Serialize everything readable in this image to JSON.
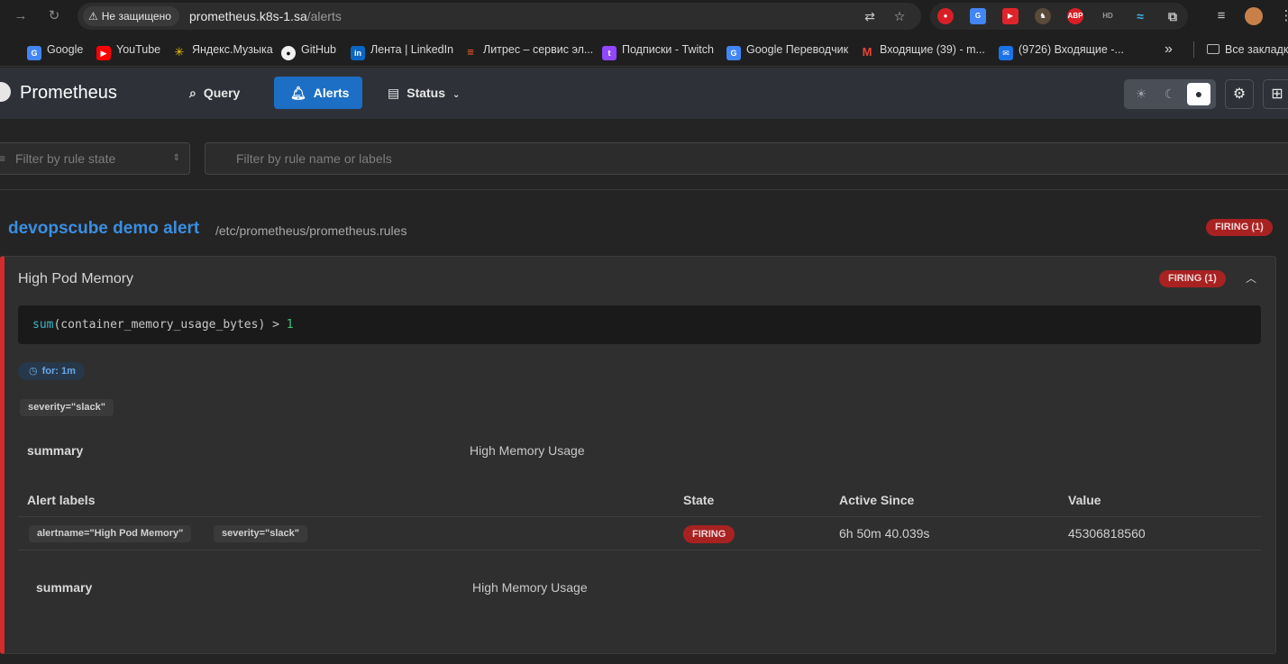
{
  "browser": {
    "security_label": "Не защищено",
    "url_host": "prometheus.k8s-1.sa",
    "url_path": "/alerts",
    "extensions": [
      "ABP",
      "HD"
    ],
    "bookmarks": [
      {
        "label": "Google",
        "color": "#4285f4",
        "glyph": "G"
      },
      {
        "label": "YouTube",
        "color": "#ff0000",
        "glyph": "▶"
      },
      {
        "label": "Яндекс.Музыка",
        "color": "#f5c400",
        "glyph": "✳"
      },
      {
        "label": "GitHub",
        "color": "#444444",
        "glyph": "●"
      },
      {
        "label": "Лента | LinkedIn",
        "color": "#0a66c2",
        "glyph": "in"
      },
      {
        "label": "Литрес – сервис эл...",
        "color": "#ff5a29",
        "glyph": "≡"
      },
      {
        "label": "Подписки - Twitch",
        "color": "#9146ff",
        "glyph": "t"
      },
      {
        "label": "Google Переводчик",
        "color": "#4285f4",
        "glyph": "G"
      },
      {
        "label": "Входящие (39) - m...",
        "color": "#d93025",
        "glyph": "M"
      },
      {
        "label": "(9726) Входящие -...",
        "color": "#1a73e8",
        "glyph": "✉"
      }
    ],
    "overflow_label": "»",
    "all_bookmarks_label": "Все закладк"
  },
  "header": {
    "brand": "Prometheus",
    "nav": {
      "query": "Query",
      "alerts": "Alerts",
      "status": "Status"
    }
  },
  "filters": {
    "state_placeholder": "Filter by rule state",
    "search_placeholder": "Filter by rule name or labels"
  },
  "group": {
    "name": "devopscube demo alert",
    "file": "/etc/prometheus/prometheus.rules",
    "badge": "FIRING (1)"
  },
  "rule": {
    "name": "High Pod Memory",
    "badge": "FIRING (1)",
    "expr_fn": "sum",
    "expr_mid": "(container_memory_usage_bytes) > ",
    "expr_num": "1",
    "for_label": "for: 1m",
    "labels": [
      "severity=\"slack\""
    ],
    "annotations": [
      {
        "key": "summary",
        "value": "High Memory Usage"
      }
    ]
  },
  "alerts_table": {
    "headers": {
      "labels": "Alert labels",
      "state": "State",
      "active_since": "Active Since",
      "value": "Value"
    },
    "rows": [
      {
        "labels": [
          "alertname=\"High Pod Memory\"",
          "severity=\"slack\""
        ],
        "state": "FIRING",
        "active_since": "6h 50m 40.039s",
        "value": "45306818560",
        "annotation_key": "summary",
        "annotation_value": "High Memory Usage"
      }
    ]
  },
  "colors": {
    "accent": "#1c6fc4",
    "firing": "#a82222",
    "group_title": "#3b8ee0",
    "rule_border": "#d52b2b"
  }
}
